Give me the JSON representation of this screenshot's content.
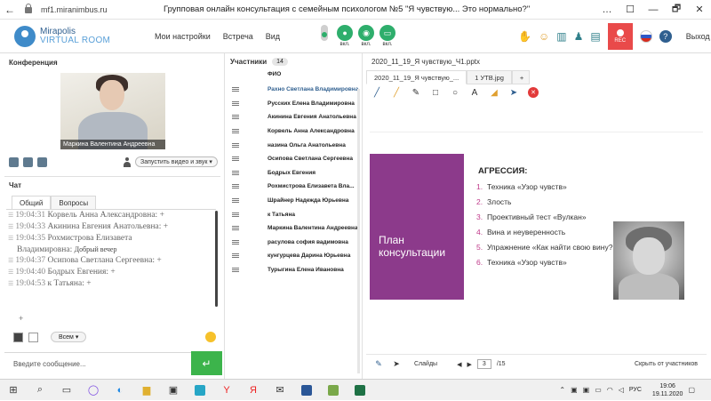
{
  "browser": {
    "back": "←",
    "url": "mf1.miranimbus.ru",
    "title": "Групповая онлайн консультация с семейным психологом №5 \"Я чувствую... Это нормально?\"",
    "window_buttons": [
      "…",
      "☐",
      "—",
      "🗗",
      "✕"
    ]
  },
  "header": {
    "logo_top": "Mirapolis",
    "logo_bottom": "VIRTUAL ROOM",
    "menu": [
      "Мои настройки",
      "Встреча",
      "Вид"
    ],
    "media": [
      {
        "name": "microphone",
        "label": "вкл."
      },
      {
        "name": "webcam",
        "label": "вкл."
      },
      {
        "name": "screen",
        "label": "вкл."
      }
    ],
    "rec_label": "REC",
    "exit_label": "Выход"
  },
  "conference": {
    "title": "Конференция",
    "video_name": "Маркина Валентина Андреевна",
    "start_video_label": "Запустить видео и звук"
  },
  "chat": {
    "title": "Чат",
    "tabs": [
      "Общий",
      "Вопросы"
    ],
    "messages": [
      {
        "time": "19:04:31",
        "text": "Корвель Анна Александровна: +"
      },
      {
        "time": "19:04:33",
        "text": "Акинина Евгения Анатольевна: +"
      },
      {
        "time": "19:04:35",
        "text": "Рохмистрова Елизавета"
      },
      {
        "time": "",
        "text": "Владимировна:",
        "extra": "Добрый вечер"
      },
      {
        "time": "19:04:37",
        "text": "Осипова Светлана Сергеевна: +"
      },
      {
        "time": "19:04:40",
        "text": "Бодрых Евгения: +"
      },
      {
        "time": "19:04:53",
        "text": "к Татьяна: +"
      }
    ],
    "plus_hint": "+",
    "recipient": "Всем",
    "input_placeholder": "Введите сообщение...",
    "send_icon": "↵"
  },
  "participants": {
    "title": "Участники",
    "count": "14",
    "fio_header": "ФИО",
    "list": [
      "Рахно Светлана Владимировна",
      "Русских Елена Владимировна",
      "Акинина Евгения Анатольевна",
      "Корвель Анна Александровна",
      "назина Ольга Анатольевна",
      "Осипова Светлана Сергеевна",
      "Бодрых Евгения",
      "Рохмистрова Елизавета Вла...",
      "Шрайнер Надежда Юрьевна",
      "к Татьяна",
      "Маркина Валентина Андреевна",
      "расулова софия вадимовна",
      "кунгурцева Дарина Юрьевна",
      "Турыгина Елена Ивановна"
    ]
  },
  "presentation": {
    "title": "2020_11_19_Я чувствую_Ч1.pptx",
    "tabs": [
      "2020_11_19_Я чувствую_...",
      "1 УТВ.jpg",
      "+"
    ],
    "slide": {
      "left_label": "План консультации",
      "heading": "АГРЕССИЯ:",
      "items": [
        {
          "num": "1.",
          "text": "Техника «Узор чувств»"
        },
        {
          "num": "2.",
          "text": "Злость"
        },
        {
          "num": "3.",
          "text": "Проективный тест «Вулкан»"
        },
        {
          "num": "4.",
          "text": "Вина и неуверенность"
        },
        {
          "num": "5.",
          "text": "Упражнение «Как найти свою вину?»"
        },
        {
          "num": "6.",
          "text": "Техника «Узор чувств»"
        }
      ]
    },
    "bottom": {
      "slides_label": "Слайды",
      "page": "3",
      "total": "/15",
      "hide_label": "Скрыть от участников"
    }
  },
  "taskbar": {
    "lang": "РУС",
    "time": "19:06",
    "date": "19.11.2020"
  },
  "colors": {
    "accent_green": "#3cb44b",
    "slide_purple": "#8c3a8b",
    "rec_red": "#e94a4a"
  }
}
